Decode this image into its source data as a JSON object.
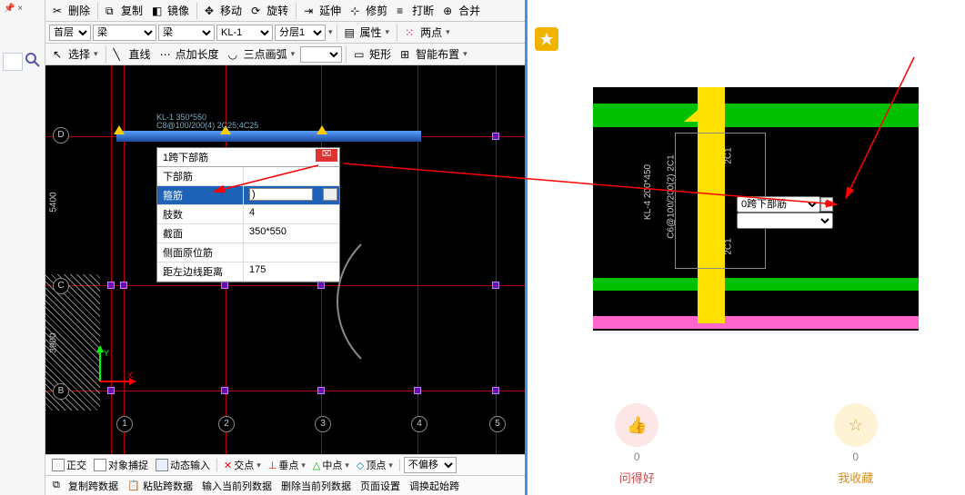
{
  "toolbars": {
    "row1": {
      "delete": "删除",
      "copy": "复制",
      "mirror": "镜像",
      "move": "移动",
      "rotate": "旋转",
      "extend": "延伸",
      "trim": "修剪",
      "break": "打断",
      "merge": "合并"
    },
    "row2": {
      "floor": "首层",
      "major": "梁",
      "type": "梁",
      "member": "KL-1",
      "sublayer": "分层1",
      "properties": "属性",
      "two_point": "两点"
    },
    "row3": {
      "select": "选择",
      "line": "直线",
      "point_extend": "点加长度",
      "three_point_arc": "三点画弧",
      "rect": "矩形",
      "smart_layout": "智能布置"
    }
  },
  "props": {
    "title": "1跨下部筋",
    "rows": [
      {
        "k": "下部筋",
        "v": ""
      },
      {
        "k": "箍筋",
        "v": ")",
        "selected": true,
        "ellipsis": true
      },
      {
        "k": "肢数",
        "v": "4"
      },
      {
        "k": "截面",
        "v": "350*550"
      },
      {
        "k": "侧面原位筋",
        "v": ""
      },
      {
        "k": "距左边线距离",
        "v": "175"
      }
    ]
  },
  "grid": {
    "v_positions": [
      75,
      205,
      320,
      430
    ],
    "h_positions": [
      70,
      225,
      350
    ],
    "col_bubbles": [
      "1",
      "2",
      "3",
      "4",
      "5"
    ],
    "row_bubbles": [
      "D",
      "C",
      "B"
    ],
    "dims": [
      "5400",
      "3900"
    ],
    "beam_label1": "KL-1 350*550",
    "beam_label2": "C8@100/200(4) 2C25;4C25"
  },
  "status": {
    "ortho": "正交",
    "osnap": "对象捕捉",
    "dyn": "动态输入",
    "cross": "交点",
    "perp": "垂点",
    "mid": "中点",
    "apex": "顶点",
    "no_offset": "不偏移"
  },
  "databar": {
    "copy_span": "复制跨数据",
    "paste_span": "粘贴跨数据",
    "input_col": "输入当前列数据",
    "delete_col": "删除当前列数据",
    "page_setup": "页面设置",
    "adjust_start": "调换起始跨"
  },
  "right": {
    "combo": "0跨下部筋",
    "beam_label": "KL-4 200*450",
    "stirrup_label": "C6@100/200(2)  2C1",
    "dim": "2C1"
  },
  "actions": {
    "like_label": "问得好",
    "like_count": "0",
    "fav_label": "我收藏",
    "fav_count": "0"
  }
}
